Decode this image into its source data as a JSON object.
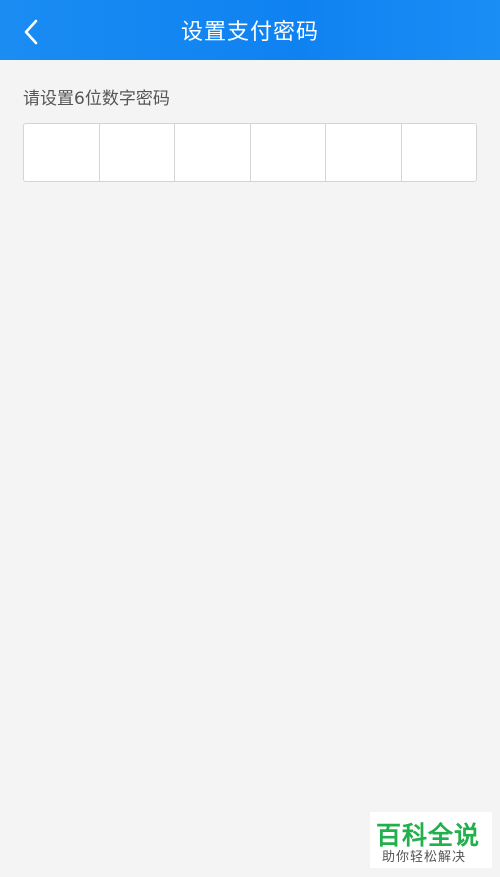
{
  "header": {
    "title": "设置支付密码",
    "back_icon": "chevron-left-icon",
    "bg_color": "#0f82f2"
  },
  "main": {
    "prompt": "请设置6位数字密码",
    "pin_length": 6
  },
  "watermark": {
    "title": "百科全说",
    "subtitle": "助你轻松解决",
    "color": "#21b04c"
  }
}
